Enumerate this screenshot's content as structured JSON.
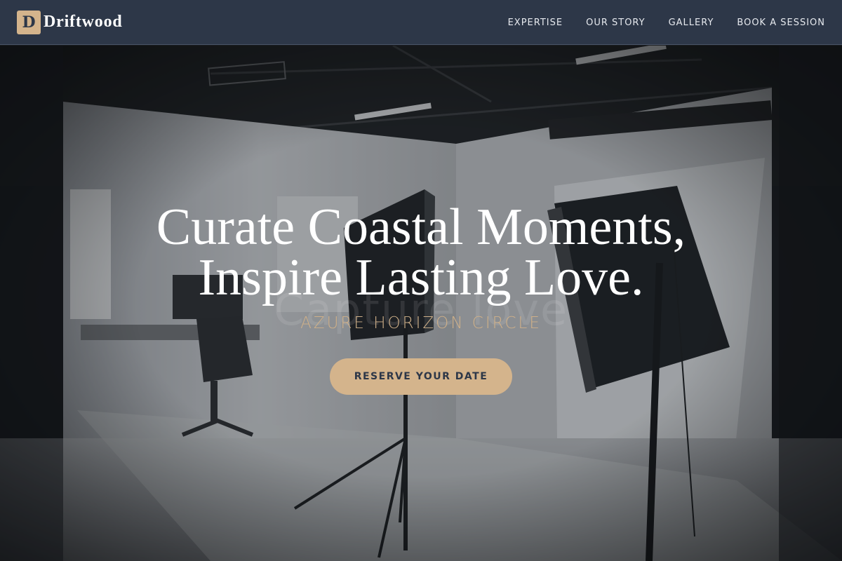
{
  "brand": {
    "mark": "D",
    "name": "Driftwood"
  },
  "nav": {
    "items": [
      {
        "label": "EXPERTISE"
      },
      {
        "label": "OUR STORY"
      },
      {
        "label": "GALLERY"
      },
      {
        "label": "BOOK A SESSION"
      }
    ]
  },
  "hero": {
    "headline_line1": "Curate Coastal Moments,",
    "headline_line2": "Inspire Lasting Love.",
    "background_text": "Capture love",
    "subtitle": "AZURE HORIZON CIRCLE",
    "cta_label": "RESERVE YOUR DATE",
    "background_image": "photo-studio-softbox-lights"
  },
  "colors": {
    "nav_bg": "#2d3748",
    "accent": "#d4b48c",
    "text_light": "#ffffff",
    "subtitle": "#cfb089"
  }
}
